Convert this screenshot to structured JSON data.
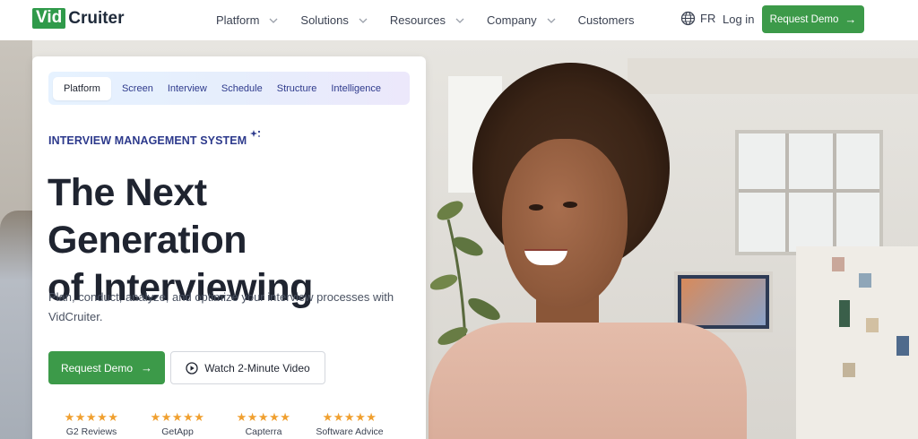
{
  "brand": {
    "logo_box": "Vid",
    "logo_rest": "Cruiter",
    "accent": "#3c9a49"
  },
  "nav": {
    "items": [
      {
        "label": "Platform",
        "has_dropdown": true
      },
      {
        "label": "Solutions",
        "has_dropdown": true
      },
      {
        "label": "Resources",
        "has_dropdown": true
      },
      {
        "label": "Company",
        "has_dropdown": true
      },
      {
        "label": "Customers",
        "has_dropdown": false
      }
    ],
    "lang": "FR",
    "login": "Log in",
    "demo": "Request Demo"
  },
  "card": {
    "tabs": [
      "Platform",
      "Screen",
      "Interview",
      "Schedule",
      "Structure",
      "Intelligence"
    ],
    "active_tab": "Platform",
    "eyebrow": "INTERVIEW MANAGEMENT SYSTEM",
    "headline_line1": "The Next Generation",
    "headline_line2": "of Interviewing",
    "description": "Plan, conduct, analyze, and optimize your interview processes with VidCruiter.",
    "primary_button": "Request Demo",
    "secondary_button": "Watch 2-Minute Video",
    "reviews": [
      {
        "label": "G2 Reviews",
        "stars": "★★★★★",
        "rating": 5
      },
      {
        "label": "GetApp",
        "stars": "★★★★★",
        "rating": 4.5
      },
      {
        "label": "Capterra",
        "stars": "★★★★★",
        "rating": 4.5
      },
      {
        "label": "Software Advice",
        "stars": "★★★★★",
        "rating": 5
      }
    ]
  }
}
